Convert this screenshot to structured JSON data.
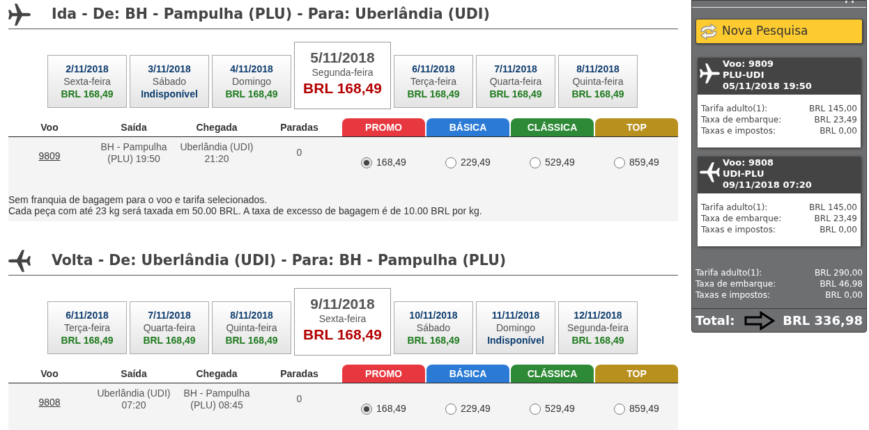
{
  "sections": [
    {
      "kind": "outbound",
      "title": "Ida - De: BH - Pampulha (PLU) - Para: Uberlândia (UDI)",
      "dates": [
        {
          "date": "2/11/2018",
          "weekday": "Sexta-feira",
          "price": "BRL 168,49",
          "available": true,
          "selected": false
        },
        {
          "date": "3/11/2018",
          "weekday": "Sábado",
          "price": "Indisponível",
          "available": false,
          "selected": false
        },
        {
          "date": "4/11/2018",
          "weekday": "Domingo",
          "price": "BRL 168,49",
          "available": true,
          "selected": false
        },
        {
          "date": "5/11/2018",
          "weekday": "Segunda-feira",
          "price": "BRL 168,49",
          "available": true,
          "selected": true
        },
        {
          "date": "6/11/2018",
          "weekday": "Terça-feira",
          "price": "BRL 168,49",
          "available": true,
          "selected": false
        },
        {
          "date": "7/11/2018",
          "weekday": "Quarta-feira",
          "price": "BRL 168,49",
          "available": true,
          "selected": false
        },
        {
          "date": "8/11/2018",
          "weekday": "Quinta-feira",
          "price": "BRL 168,49",
          "available": true,
          "selected": false
        }
      ],
      "columns": [
        "Voo",
        "Saída",
        "Chegada",
        "Paradas"
      ],
      "fares": [
        {
          "label": "PROMO",
          "color": "#e8383f"
        },
        {
          "label": "BÁSICA",
          "color": "#2b7bd6"
        },
        {
          "label": "CLÁSSICA",
          "color": "#2e8a36"
        },
        {
          "label": "TOP",
          "color": "#b8901e"
        }
      ],
      "flights": [
        {
          "number": "9809",
          "departure": "BH - Pampulha (PLU) 19:50",
          "arrival": "Uberlândia (UDI) 21:20",
          "stops": "0",
          "options": [
            {
              "price": "168,49",
              "selected": true
            },
            {
              "price": "229,49",
              "selected": false
            },
            {
              "price": "529,49",
              "selected": false
            },
            {
              "price": "859,49",
              "selected": false
            }
          ]
        }
      ],
      "notes": [
        "Sem franquia de bagagem para o voo e tarifa selecionados.",
        "Cada peça com até 23 kg será taxada em 50.00 BRL. A taxa de excesso de bagagem é de 10.00 BRL por kg."
      ]
    },
    {
      "kind": "return",
      "title": "Volta - De: Uberlândia (UDI) - Para: BH - Pampulha (PLU)",
      "dates": [
        {
          "date": "6/11/2018",
          "weekday": "Terça-feira",
          "price": "BRL 168,49",
          "available": true,
          "selected": false
        },
        {
          "date": "7/11/2018",
          "weekday": "Quarta-feira",
          "price": "BRL 168,49",
          "available": true,
          "selected": false
        },
        {
          "date": "8/11/2018",
          "weekday": "Quinta-feira",
          "price": "BRL 168,49",
          "available": true,
          "selected": false
        },
        {
          "date": "9/11/2018",
          "weekday": "Sexta-feira",
          "price": "BRL 168,49",
          "available": true,
          "selected": true
        },
        {
          "date": "10/11/2018",
          "weekday": "Sábado",
          "price": "BRL 168,49",
          "available": true,
          "selected": false
        },
        {
          "date": "11/11/2018",
          "weekday": "Domingo",
          "price": "Indisponível",
          "available": false,
          "selected": false
        },
        {
          "date": "12/11/2018",
          "weekday": "Segunda-feira",
          "price": "BRL 168,49",
          "available": true,
          "selected": false
        }
      ],
      "columns": [
        "Voo",
        "Saída",
        "Chegada",
        "Paradas"
      ],
      "fares": [
        {
          "label": "PROMO",
          "color": "#e8383f"
        },
        {
          "label": "BÁSICA",
          "color": "#2b7bd6"
        },
        {
          "label": "CLÁSSICA",
          "color": "#2e8a36"
        },
        {
          "label": "TOP",
          "color": "#b8901e"
        }
      ],
      "flights": [
        {
          "number": "9808",
          "departure": "Uberlândia (UDI) 07:20",
          "arrival": "BH - Pampulha (PLU) 08:45",
          "stops": "0",
          "options": [
            {
              "price": "168,49",
              "selected": true
            },
            {
              "price": "229,49",
              "selected": false
            },
            {
              "price": "529,49",
              "selected": false
            },
            {
              "price": "859,49",
              "selected": false
            }
          ]
        }
      ]
    }
  ],
  "sidebar": {
    "new_search_button": "Nova Pesquisa",
    "flights": [
      {
        "kind": "outbound",
        "number": "Voo: 9809",
        "route": "PLU-UDI",
        "datetime": "05/11/2018 19:50",
        "lines": [
          {
            "label": "Tarifa adulto(1):",
            "value": "BRL 145,00"
          },
          {
            "label": "Taxa de embarque:",
            "value": "BRL 23,49"
          },
          {
            "label": "Taxas e impostos:",
            "value": "BRL 0,00"
          }
        ]
      },
      {
        "kind": "return",
        "number": "Voo: 9808",
        "route": "UDI-PLU",
        "datetime": "09/11/2018 07:20",
        "lines": [
          {
            "label": "Tarifa adulto(1):",
            "value": "BRL 145,00"
          },
          {
            "label": "Taxa de embarque:",
            "value": "BRL 23,49"
          },
          {
            "label": "Taxas e impostos:",
            "value": "BRL 0,00"
          }
        ]
      }
    ],
    "summary": [
      {
        "label": "Tarifa adulto(1):",
        "value": "BRL 290,00"
      },
      {
        "label": "Taxa de embarque:",
        "value": "BRL 46,98"
      },
      {
        "label": "Taxas e impostos:",
        "value": "BRL 0,00"
      }
    ],
    "total": {
      "label": "Total:",
      "value": "BRL 336,98"
    }
  }
}
